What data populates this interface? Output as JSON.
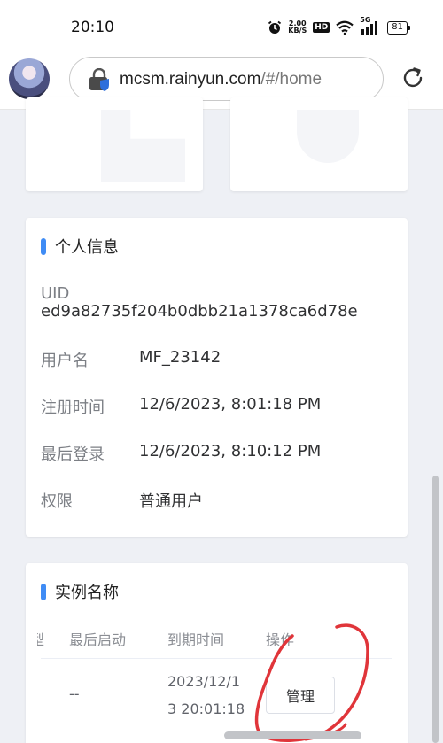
{
  "status_bar": {
    "time": "20:10",
    "speed_value": "2.00",
    "speed_unit": "KB/S",
    "hd": "HD",
    "network": "5G",
    "battery": "81"
  },
  "browser": {
    "url_host": "mcsm.rainyun.com",
    "url_path": "/#/home"
  },
  "info_card": {
    "title": "个人信息",
    "uid_label": "UID",
    "uid_value": "ed9a82735f204b0dbb21a1378ca6d78e",
    "rows": [
      {
        "label": "用户名",
        "value": "MF_23142"
      },
      {
        "label": "注册时间",
        "value": "12/6/2023, 8:01:18 PM"
      },
      {
        "label": "最后登录",
        "value": "12/6/2023, 8:10:12 PM"
      },
      {
        "label": "权限",
        "value": "普通用户"
      }
    ]
  },
  "instance_card": {
    "title": "实例名称",
    "headers": [
      "型",
      "最后启动",
      "到期时间",
      "操作"
    ],
    "row": {
      "last_start": "--",
      "expire_line1": "2023/12/1",
      "expire_line2": "3 20:01:18",
      "action": "管理"
    }
  },
  "colors": {
    "accent": "#3f8cf5",
    "background": "#eef0f5",
    "annotation": "#e0353a"
  },
  "icons": [
    "alarm-icon",
    "wifi-icon",
    "signal-icon",
    "battery-icon",
    "lock-icon",
    "reload-icon",
    "avatar"
  ]
}
